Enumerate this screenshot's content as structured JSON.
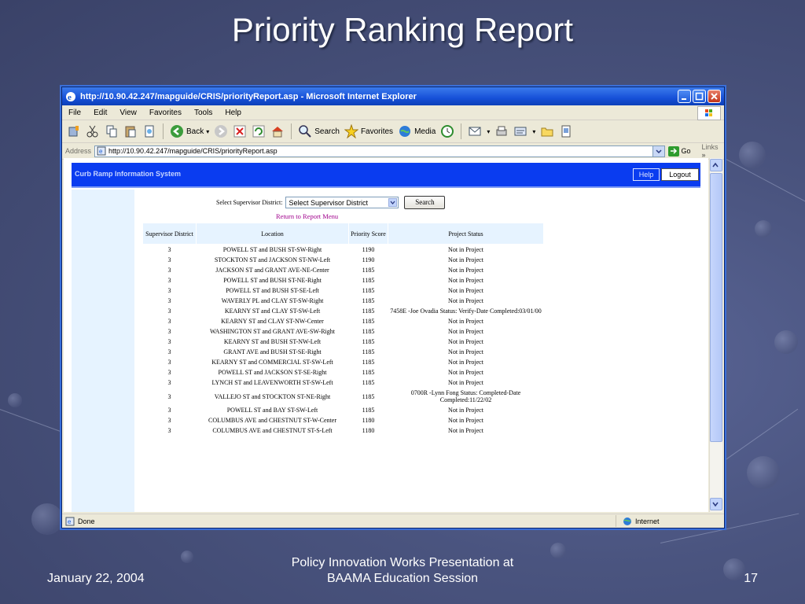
{
  "slide": {
    "title": "Priority Ranking Report",
    "footer_date": "January 22, 2004",
    "footer_center_line1": "Policy Innovation Works Presentation at",
    "footer_center_line2": "BAAMA Education Session",
    "page_number": "17"
  },
  "browser": {
    "title": "http://10.90.42.247/mapguide/CRIS/priorityReport.asp - Microsoft Internet Explorer",
    "menu": [
      "File",
      "Edit",
      "View",
      "Favorites",
      "Tools",
      "Help"
    ],
    "toolbar": {
      "back": "Back",
      "search": "Search",
      "favorites": "Favorites",
      "media": "Media"
    },
    "address_label": "Address",
    "address_url": "http://10.90.42.247/mapguide/CRIS/priorityReport.asp",
    "go_label": "Go",
    "links_label": "Links",
    "status_text": "Done",
    "zone_text": "Internet"
  },
  "app": {
    "header_title": "Curb Ramp Information System",
    "help_label": "Help",
    "logout_label": "Logout",
    "filter_label": "Select Supervisor District:",
    "filter_value": "Select Supervisor District",
    "search_label": "Search",
    "return_link": "Return to Report Menu"
  },
  "table": {
    "headers": [
      "Supervisor District",
      "Location",
      "Priority Score",
      "Project Status"
    ],
    "rows": [
      [
        "3",
        "POWELL ST and BUSH ST-SW-Right",
        "1190",
        "Not in Project"
      ],
      [
        "3",
        "STOCKTON ST and JACKSON ST-NW-Left",
        "1190",
        "Not in Project"
      ],
      [
        "3",
        "JACKSON ST and GRANT AVE-NE-Center",
        "1185",
        "Not in Project"
      ],
      [
        "3",
        "POWELL ST and BUSH ST-NE-Right",
        "1185",
        "Not in Project"
      ],
      [
        "3",
        "POWELL ST and BUSH ST-SE-Left",
        "1185",
        "Not in Project"
      ],
      [
        "3",
        "WAVERLY PL and CLAY ST-SW-Right",
        "1185",
        "Not in Project"
      ],
      [
        "3",
        "KEARNY ST and CLAY ST-SW-Left",
        "1185",
        "7458E -Joe Ovadia Status: Verify-Date Completed:03/01/00"
      ],
      [
        "3",
        "KEARNY ST and CLAY ST-NW-Center",
        "1185",
        "Not in Project"
      ],
      [
        "3",
        "WASHINGTON ST and GRANT AVE-SW-Right",
        "1185",
        "Not in Project"
      ],
      [
        "3",
        "KEARNY ST and BUSH ST-NW-Left",
        "1185",
        "Not in Project"
      ],
      [
        "3",
        "GRANT AVE and BUSH ST-SE-Right",
        "1185",
        "Not in Project"
      ],
      [
        "3",
        "KEARNY ST and COMMERCIAL ST-SW-Left",
        "1185",
        "Not in Project"
      ],
      [
        "3",
        "POWELL ST and JACKSON ST-SE-Right",
        "1185",
        "Not in Project"
      ],
      [
        "3",
        "LYNCH ST and LEAVENWORTH ST-SW-Left",
        "1185",
        "Not in Project"
      ],
      [
        "3",
        "VALLEJO ST and STOCKTON ST-NE-Right",
        "1185",
        "0700R -Lynn Fong Status: Completed-Date Completed:11/22/02"
      ],
      [
        "3",
        "POWELL ST and BAY ST-SW-Left",
        "1185",
        "Not in Project"
      ],
      [
        "3",
        "COLUMBUS AVE and CHESTNUT ST-W-Center",
        "1180",
        "Not in Project"
      ],
      [
        "3",
        "COLUMBUS AVE and CHESTNUT ST-S-Left",
        "1180",
        "Not in Project"
      ]
    ]
  }
}
